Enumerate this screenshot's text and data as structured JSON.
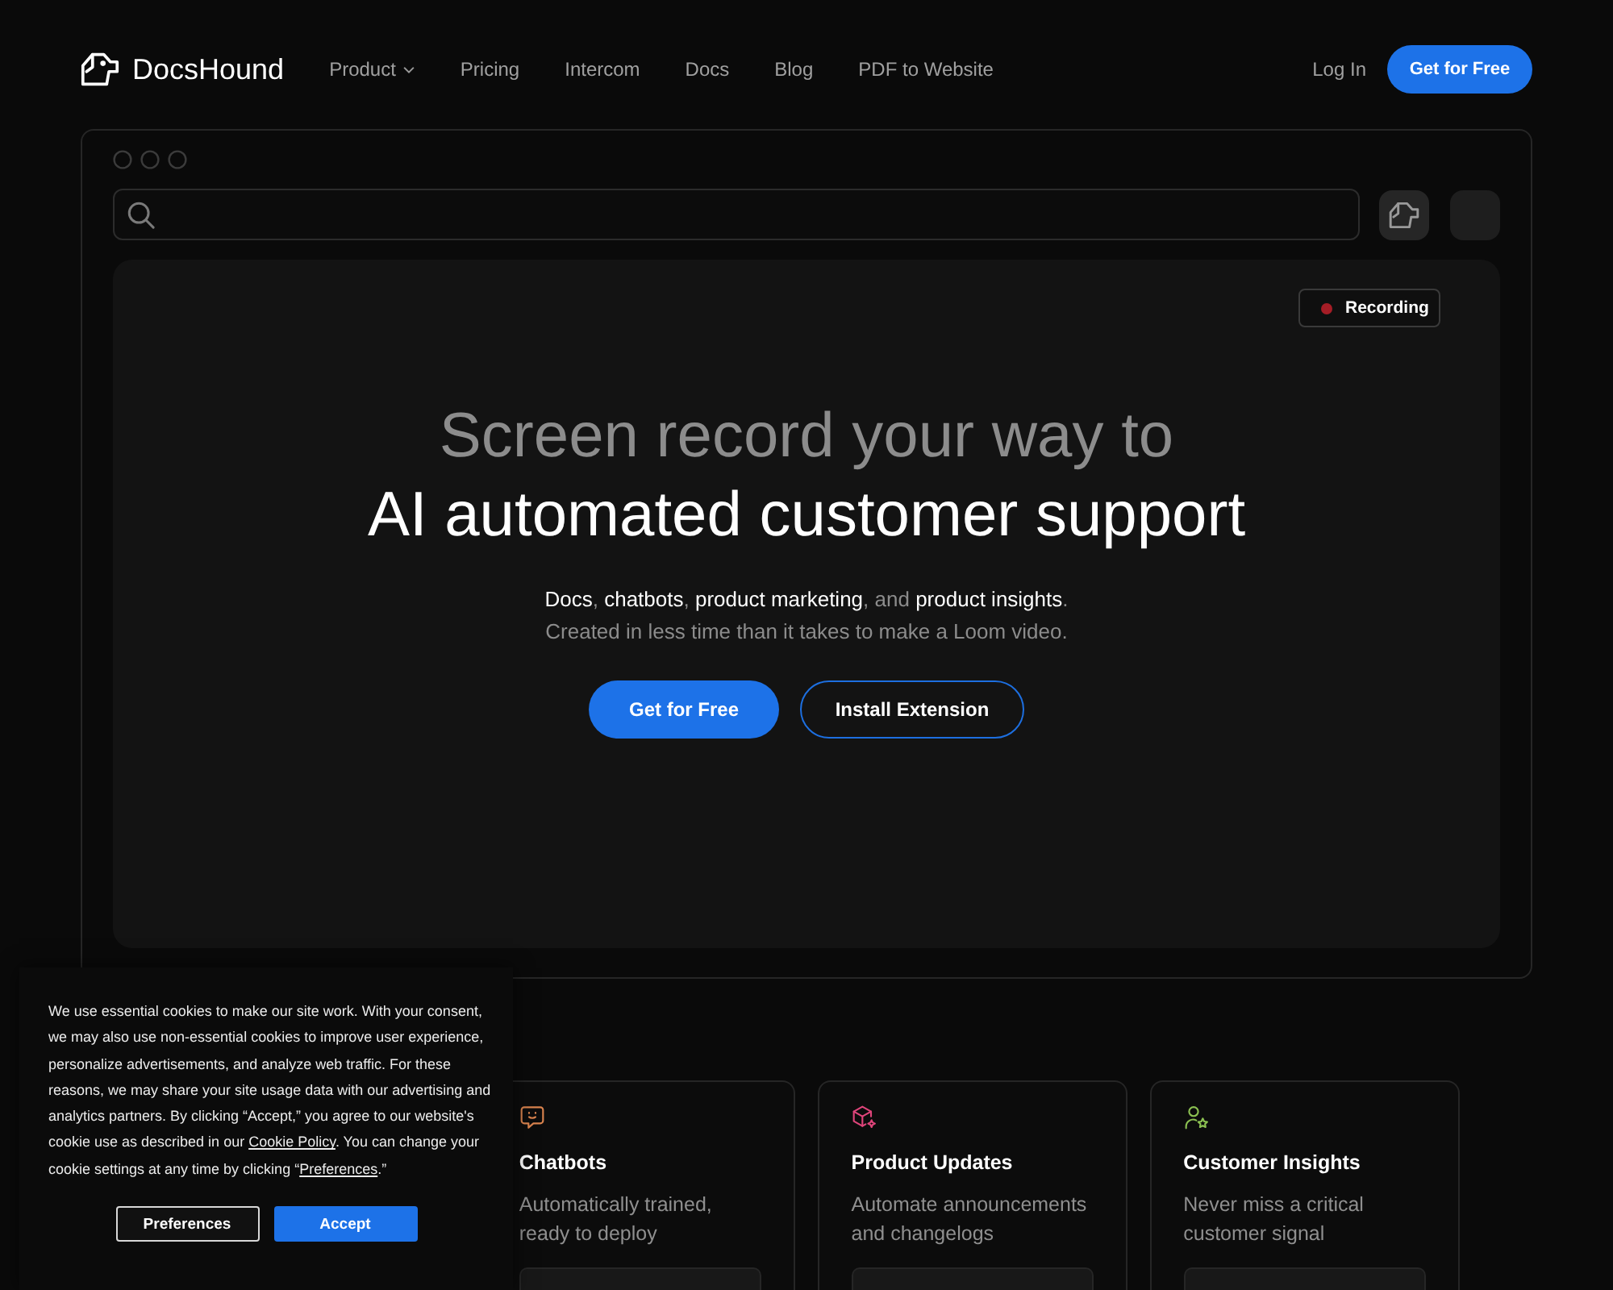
{
  "nav": {
    "logo": "DocsHound",
    "links": [
      {
        "label": "Product",
        "dropdown": true
      },
      {
        "label": "Pricing",
        "dropdown": false
      },
      {
        "label": "Intercom",
        "dropdown": false
      },
      {
        "label": "Docs",
        "dropdown": false
      },
      {
        "label": "Blog",
        "dropdown": false
      },
      {
        "label": "PDF to Website",
        "dropdown": false
      }
    ],
    "login": "Log In",
    "cta": "Get for Free"
  },
  "hero": {
    "badge": "Recording",
    "title_lead": "Screen record your way to",
    "title_main": "AI automated customer support",
    "subtitle": "**Docs**, **chatbots**, **product marketing**, and **product insights**.",
    "tagline": "Created in less time than it takes to make a Loom video.",
    "buttons": [
      {
        "label": "Get for Free",
        "kind": "primary"
      },
      {
        "label": "Install Extension",
        "kind": "outline"
      }
    ]
  },
  "feature_cards": [
    {
      "title": "Chatbots",
      "description": "Automatically trained, ready to deploy",
      "color": "#d9834e"
    },
    {
      "title": "Product Updates",
      "description": "Automate announcements and changelogs",
      "color": "#e0457b"
    },
    {
      "title": "Customer Insights",
      "description": "Never miss a critical customer signal",
      "color": "#8cc152"
    }
  ],
  "cookie_banner": {
    "segments": [
      {
        "kind": "text",
        "text": "We use essential cookies to make our site work. With your consent, we may also use non-essential cookies to improve user experience, personalize advertisements, and analyze web traffic. For these reasons, we may share your site usage data with our advertising and analytics partners. By clicking “Accept,” you agree to our website's cookie use as described in our "
      },
      {
        "kind": "link",
        "text": "Cookie Policy"
      },
      {
        "kind": "text",
        "text": ". You can change your cookie settings at any time by clicking “"
      },
      {
        "kind": "link",
        "text": "Preferences"
      },
      {
        "kind": "text",
        "text": ".”"
      }
    ],
    "buttons": [
      {
        "label": "Preferences",
        "kind": "outline"
      },
      {
        "label": "Accept",
        "kind": "primary"
      }
    ]
  }
}
